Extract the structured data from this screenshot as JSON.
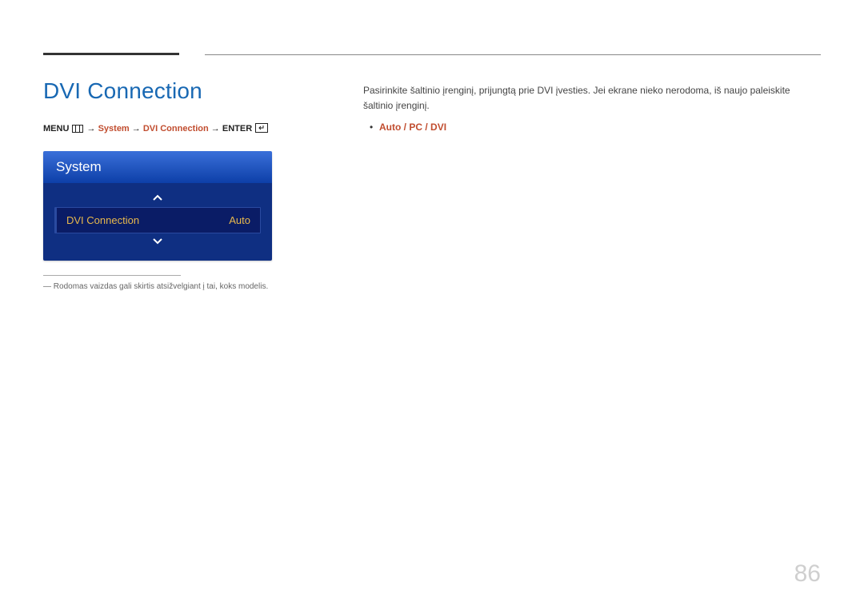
{
  "section": {
    "title": "DVI Connection"
  },
  "path": {
    "menu": "MENU",
    "step1": "System",
    "step2": "DVI Connection",
    "enter": "ENTER"
  },
  "osd": {
    "header": "System",
    "row_label": "DVI Connection",
    "row_value": "Auto"
  },
  "footnote": "Rodomas vaizdas gali skirtis atsižvelgiant į tai, koks modelis.",
  "description": "Pasirinkite šaltinio įrenginį, prijungtą prie DVI įvesties. Jei ekrane nieko nerodoma, iš naujo paleiskite šaltinio įrenginį.",
  "options": {
    "o1": "Auto",
    "sep1": " / ",
    "o2": "PC",
    "sep2": " / ",
    "o3": "DVI"
  },
  "page_number": "86"
}
